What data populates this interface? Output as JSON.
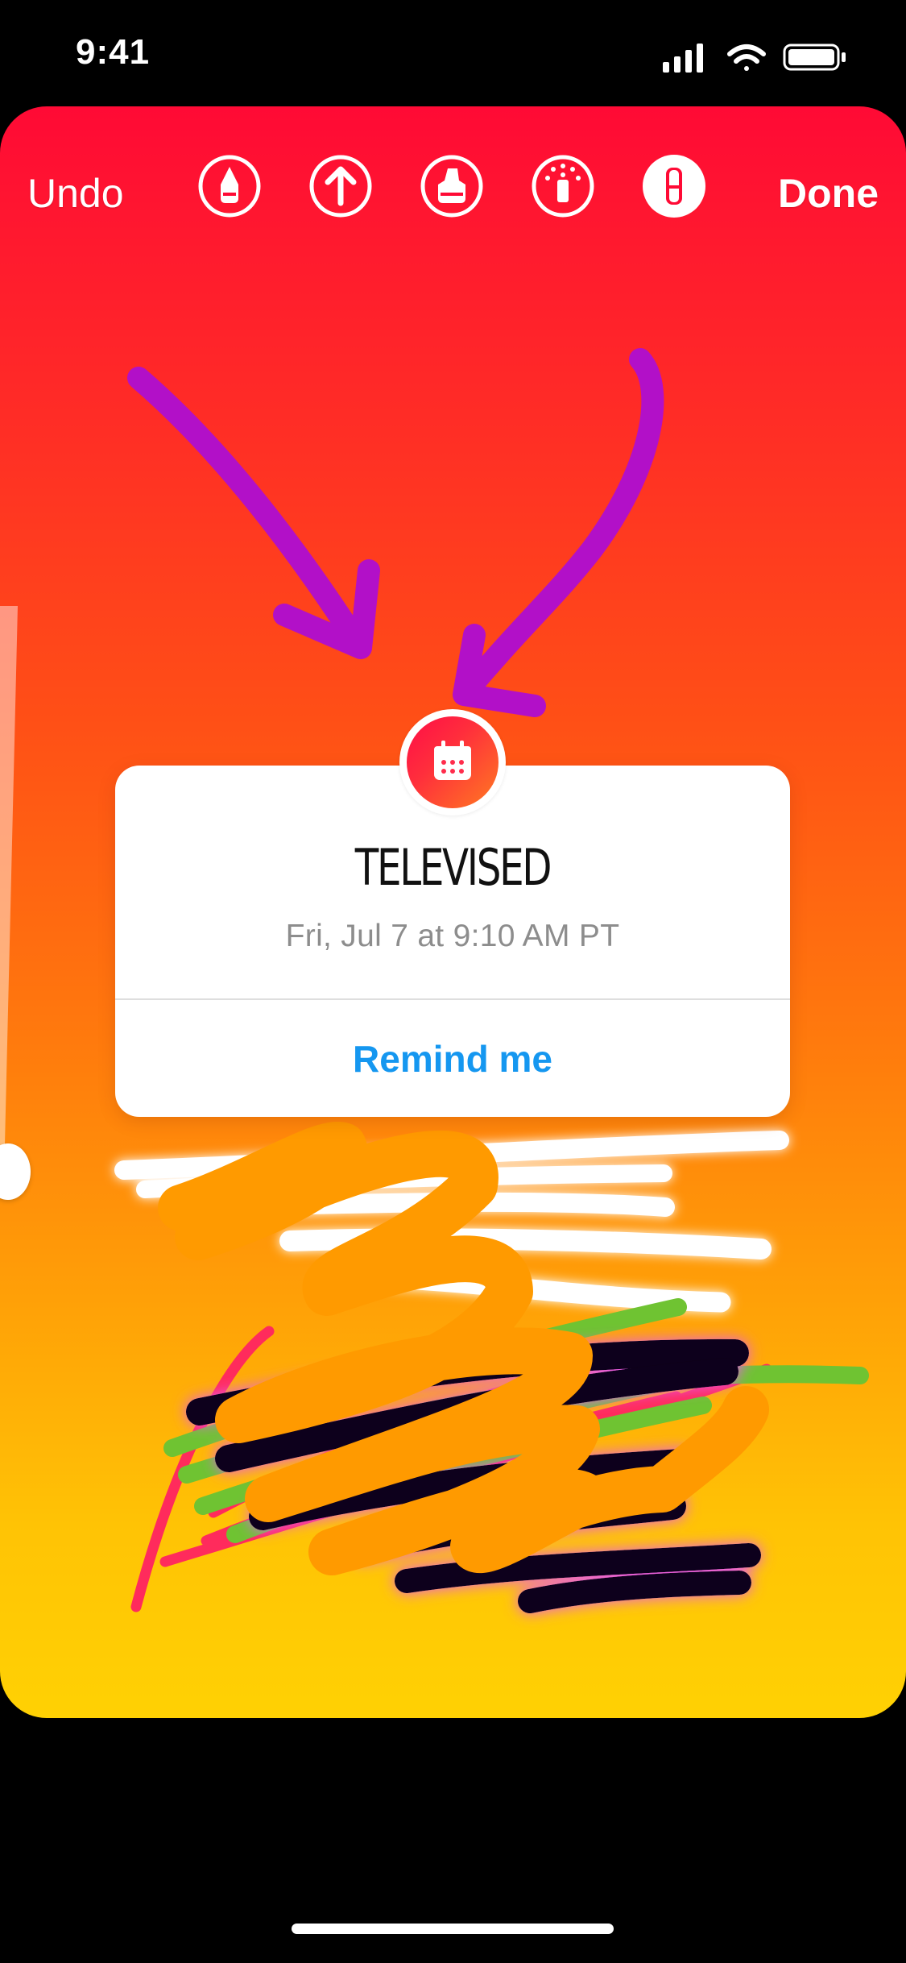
{
  "status_bar": {
    "time": "9:41"
  },
  "toolbar": {
    "undo_label": "Undo",
    "done_label": "Done",
    "tools": [
      {
        "name": "marker-pen-icon"
      },
      {
        "name": "arrow-pen-icon"
      },
      {
        "name": "highlighter-pen-icon"
      },
      {
        "name": "glow-pen-icon"
      },
      {
        "name": "eraser-icon"
      }
    ]
  },
  "countdown_sticker": {
    "title": "TELEVISED",
    "date_time": "Fri, Jul 7 at 9:10 AM PT",
    "button_label": "Remind me",
    "icon": "calendar-icon"
  },
  "colors": {
    "background_top": "#ff0a35",
    "background_bottom": "#ffd103",
    "accent_blue": "#1597f0",
    "purple_ink": "#b210c8",
    "orange_ink": "#ff9a00"
  }
}
